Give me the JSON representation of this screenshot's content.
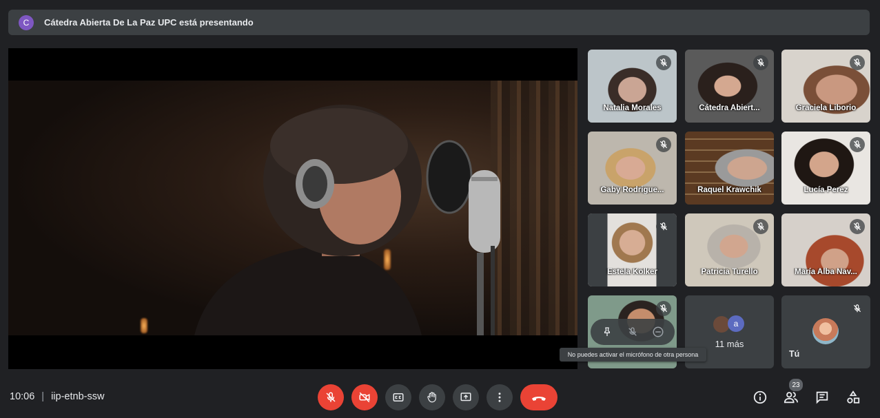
{
  "banner": {
    "avatar_letter": "C",
    "text": "Cátedra Abierta De La Paz UPC está presentando"
  },
  "tiles": [
    {
      "name": "Natalia Morales"
    },
    {
      "name": "Cátedra Abiert..."
    },
    {
      "name": "Graciela Liborio"
    },
    {
      "name": "Gaby Rodrigue..."
    },
    {
      "name": "Raquel Krawchik"
    },
    {
      "name": "Lucía Perez"
    },
    {
      "name": "Estela Kolker"
    },
    {
      "name": "Patricia Turello"
    },
    {
      "name": "María Alba Nav..."
    }
  ],
  "more_tile": {
    "avatar_letter": "a",
    "label": "11 más"
  },
  "me_tile": {
    "label": "Tú"
  },
  "tooltip": "No puedes activar el micrófono de otra persona",
  "meeting": {
    "time": "10:06",
    "code": "iip-etnb-ssw"
  },
  "people_count": "23",
  "colors": {
    "accent_red": "#ea4335",
    "background": "#202124",
    "surface": "#3c4043"
  }
}
